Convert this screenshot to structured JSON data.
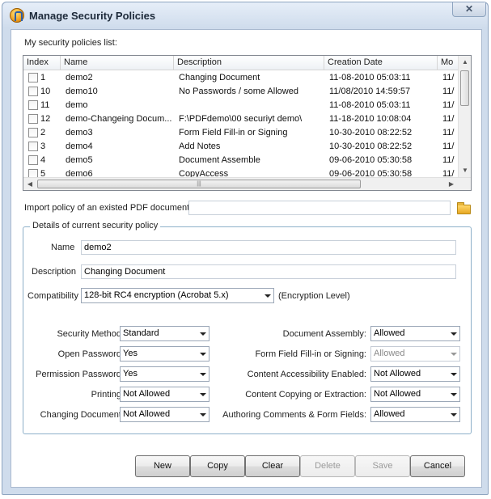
{
  "window": {
    "title": "Manage Security Policies",
    "close_glyph": "✕"
  },
  "list": {
    "caption": "My security policies list:",
    "columns": [
      "Index",
      "Name",
      "Description",
      "Creation Date",
      "Mo"
    ],
    "rows": [
      {
        "index": "1",
        "name": "demo2",
        "description": "Changing Document",
        "created": "11-08-2010  05:03:11",
        "modified": "11/"
      },
      {
        "index": "10",
        "name": "demo10",
        "description": "No Passwords / some Allowed",
        "created": "11/08/2010 14:59:57",
        "modified": "11/"
      },
      {
        "index": "11",
        "name": "demo",
        "description": "",
        "created": "11-08-2010  05:03:11",
        "modified": "11/"
      },
      {
        "index": "12",
        "name": "demo-Changeing Docum...",
        "description": "F:\\PDFdemo\\00 securiyt demo\\",
        "created": "11-18-2010  10:08:04",
        "modified": "11/"
      },
      {
        "index": "2",
        "name": "demo3",
        "description": "Form Field Fill-in or Signing",
        "created": "10-30-2010  08:22:52",
        "modified": "11/"
      },
      {
        "index": "3",
        "name": "demo4",
        "description": "Add Notes",
        "created": "10-30-2010  08:22:52",
        "modified": "11/"
      },
      {
        "index": "4",
        "name": "demo5",
        "description": "Document Assemble",
        "created": "09-06-2010  05:30:58",
        "modified": "11/"
      },
      {
        "index": "5",
        "name": "demo6",
        "description": "CopyAccess",
        "created": "09-06-2010  05:30:58",
        "modified": "11/"
      }
    ]
  },
  "import": {
    "label": "Import policy of an existed PDF document",
    "value": "",
    "icon": "folder-icon"
  },
  "details": {
    "legend": "Details of current security policy",
    "name_label": "Name",
    "name_value": "demo2",
    "description_label": "Description",
    "description_value": "Changing Document",
    "compat_label": "Compatibility",
    "compat_value": "128-bit RC4 encryption (Acrobat 5.x)",
    "compat_hint": "(Encryption Level)",
    "left_fields": [
      {
        "label": "Security Method:",
        "value": "Standard"
      },
      {
        "label": "Open Password:",
        "value": "Yes"
      },
      {
        "label": "Permission Password:",
        "value": "Yes"
      },
      {
        "label": "Printing:",
        "value": "Not Allowed"
      },
      {
        "label": "Changing Document:",
        "value": "Not Allowed"
      }
    ],
    "right_fields": [
      {
        "label": "Document Assembly:",
        "value": "Allowed",
        "disabled": false
      },
      {
        "label": "Form Field Fill-in or Signing:",
        "value": "Allowed",
        "disabled": true
      },
      {
        "label": "Content Accessibility Enabled:",
        "value": "Not Allowed",
        "disabled": false
      },
      {
        "label": "Content Copying or Extraction:",
        "value": "Not Allowed",
        "disabled": false
      },
      {
        "label": "Authoring Comments & Form Fields:",
        "value": "Allowed",
        "disabled": false
      }
    ]
  },
  "buttons": [
    {
      "label": "New",
      "enabled": true
    },
    {
      "label": "Copy",
      "enabled": true
    },
    {
      "label": "Clear",
      "enabled": true
    },
    {
      "label": "Delete",
      "enabled": false
    },
    {
      "label": "Save",
      "enabled": false
    },
    {
      "label": "Cancel",
      "enabled": true
    }
  ]
}
